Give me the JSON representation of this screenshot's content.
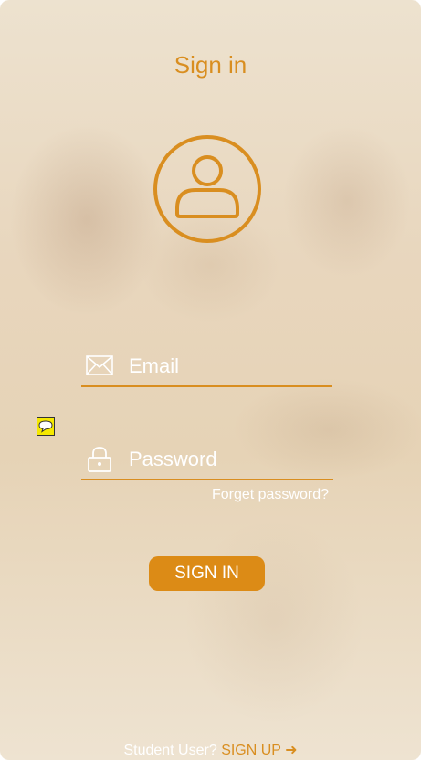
{
  "screen": {
    "title": "Sign in"
  },
  "form": {
    "email_placeholder": "Email",
    "password_placeholder": "Password",
    "forgot_label": "Forget password?",
    "signin_label": "SIGN IN"
  },
  "footer": {
    "prompt": "Student User?",
    "signup_label": "SIGN UP",
    "signup_arrow": "➜"
  },
  "icons": {
    "avatar": "user-avatar-icon",
    "email": "envelope-icon",
    "password": "lock-icon",
    "chat": "chat-bubble-icon"
  },
  "colors": {
    "accent": "#d98e20",
    "button": "#dc8b16",
    "text_light": "#ffffff"
  }
}
